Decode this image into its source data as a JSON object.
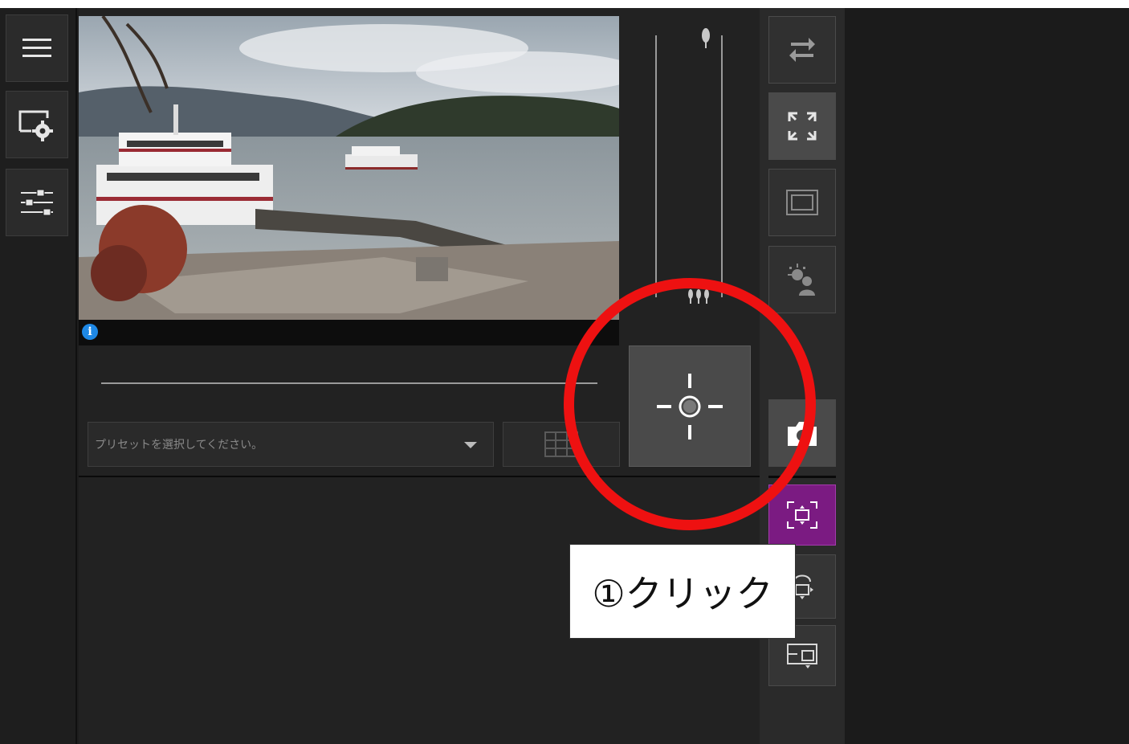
{
  "left_nav": {
    "items": [
      {
        "icon": "menu-icon"
      },
      {
        "icon": "display-settings-icon"
      },
      {
        "icon": "sliders-icon"
      }
    ]
  },
  "video": {
    "scene": "lake-pier-with-ferries",
    "info_icon_glyph": "i"
  },
  "preset": {
    "placeholder": "プリセットを選択してください。"
  },
  "controls": {
    "center_button_icon": "crosshair-icon",
    "zoom_tele_icon": "tree-single-icon",
    "zoom_wide_icon": "tree-group-icon"
  },
  "right_toolbar": {
    "buttons": [
      {
        "icon": "swap-arrows-icon"
      },
      {
        "icon": "fullscreen-icon"
      },
      {
        "icon": "frame-icon"
      },
      {
        "icon": "brightness-person-icon"
      },
      {
        "icon": "camera-icon"
      },
      {
        "icon": "area-zoom-icon",
        "active": true
      },
      {
        "icon": "auto-track-icon"
      },
      {
        "icon": "area-compare-icon"
      }
    ]
  },
  "annotation": {
    "callout_text": "①クリック",
    "highlight_color": "#ee1111",
    "active_color": "#7b1b82"
  }
}
